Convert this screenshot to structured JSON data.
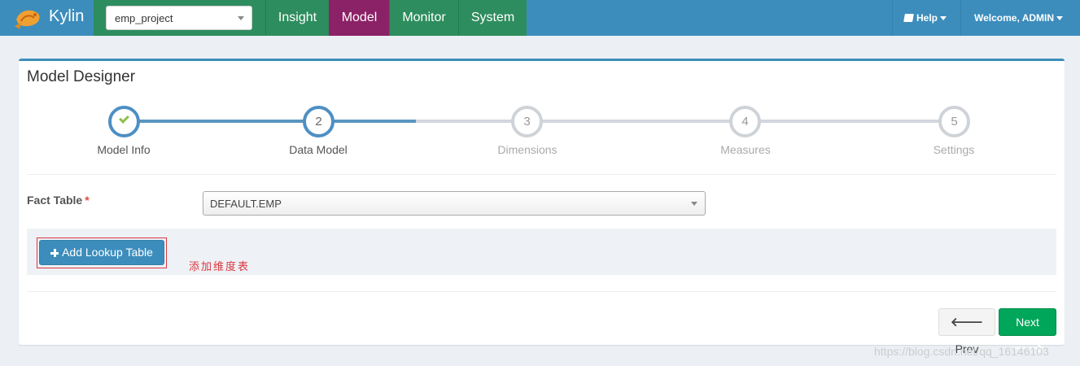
{
  "navbar": {
    "brand": "Kylin",
    "project_selected": "emp_project",
    "nav_items": [
      "Insight",
      "Model",
      "Monitor",
      "System"
    ],
    "help_label": "Help",
    "welcome_label": "Welcome, ADMIN",
    "colors": {
      "navbar": "#3c8dbc",
      "nav_item": "#2e8d5e",
      "nav_active": "#8b2166"
    }
  },
  "page": {
    "title": "Model Designer"
  },
  "wizard": {
    "steps": [
      {
        "number": "",
        "label": "Model Info",
        "state": "done"
      },
      {
        "number": "2",
        "label": "Data Model",
        "state": "active"
      },
      {
        "number": "3",
        "label": "Dimensions",
        "state": "inactive"
      },
      {
        "number": "4",
        "label": "Measures",
        "state": "inactive"
      },
      {
        "number": "5",
        "label": "Settings",
        "state": "inactive"
      }
    ]
  },
  "form": {
    "fact_table_label": "Fact Table",
    "required_mark": "*",
    "fact_table_value": "DEFAULT.EMP",
    "add_lookup_label": "Add Lookup Table",
    "annotation": "添加维度表"
  },
  "footer": {
    "prev_label": "Prev",
    "next_label": "Next"
  },
  "watermark": "https://blog.csdn.net/qq_16146103"
}
